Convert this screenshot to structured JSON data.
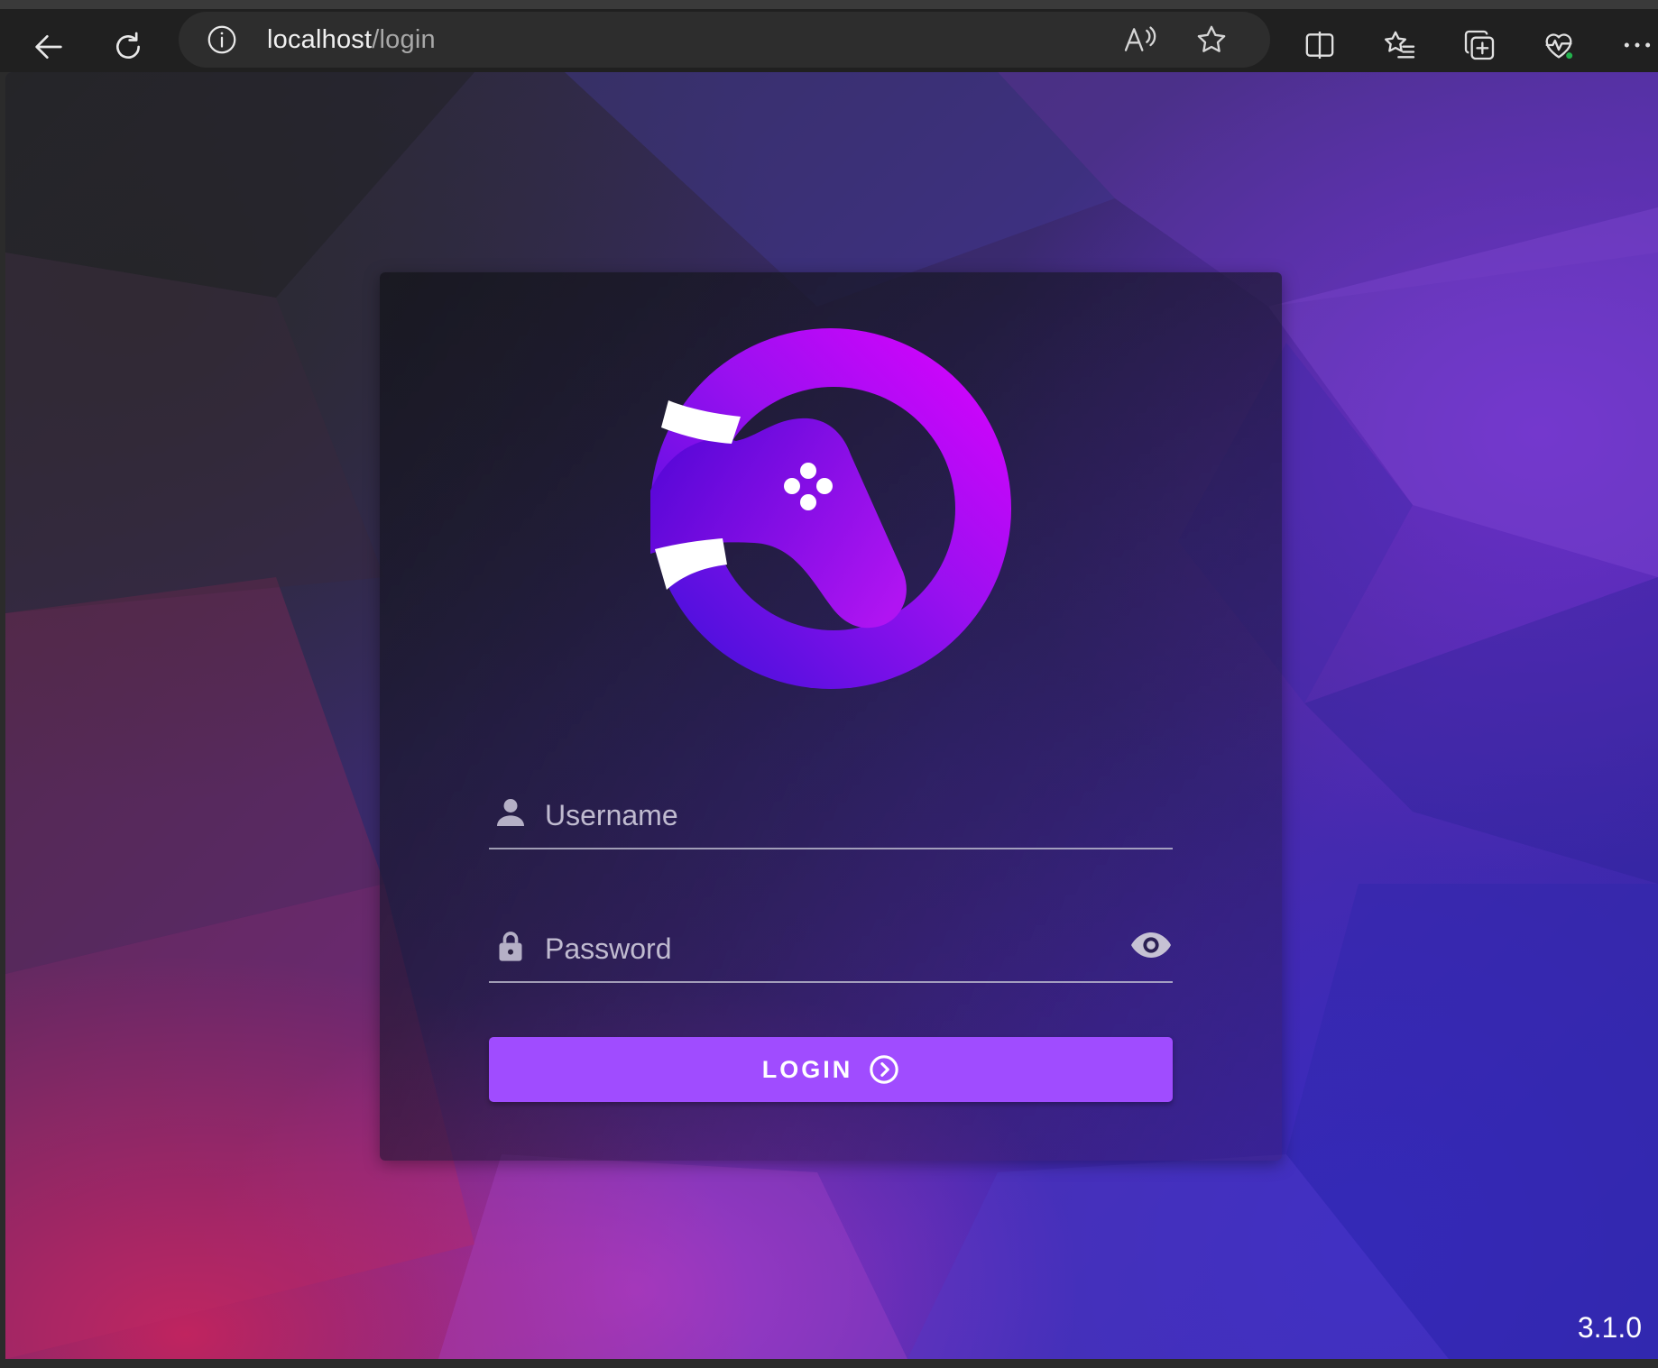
{
  "browser": {
    "url_host": "localhost",
    "url_path": "/login",
    "icons": {
      "back": "arrow-left-icon",
      "refresh": "refresh-icon",
      "site_info": "info-icon",
      "read_aloud": "read-aloud-icon",
      "favorite": "star-icon",
      "split_screen": "split-screen-icon",
      "favorites": "favorites-list-icon",
      "collections": "collections-icon",
      "browser_essentials": "heart-pulse-icon",
      "more": "more-dots-icon"
    }
  },
  "login": {
    "username_placeholder": "Username",
    "username_value": "",
    "password_placeholder": "Password",
    "password_value": "",
    "button_label": "LOGIN",
    "icons": {
      "username": "person-icon",
      "password": "lock-icon",
      "toggle_visibility": "eye-icon",
      "button": "chevron-right-circle-icon",
      "logo": "gamepad-logo-icon"
    }
  },
  "footer": {
    "version": "3.1.0"
  },
  "colors": {
    "accent": "#a04cff",
    "logo_gradient_start": "#3a10d8",
    "logo_gradient_end": "#e000ff"
  }
}
